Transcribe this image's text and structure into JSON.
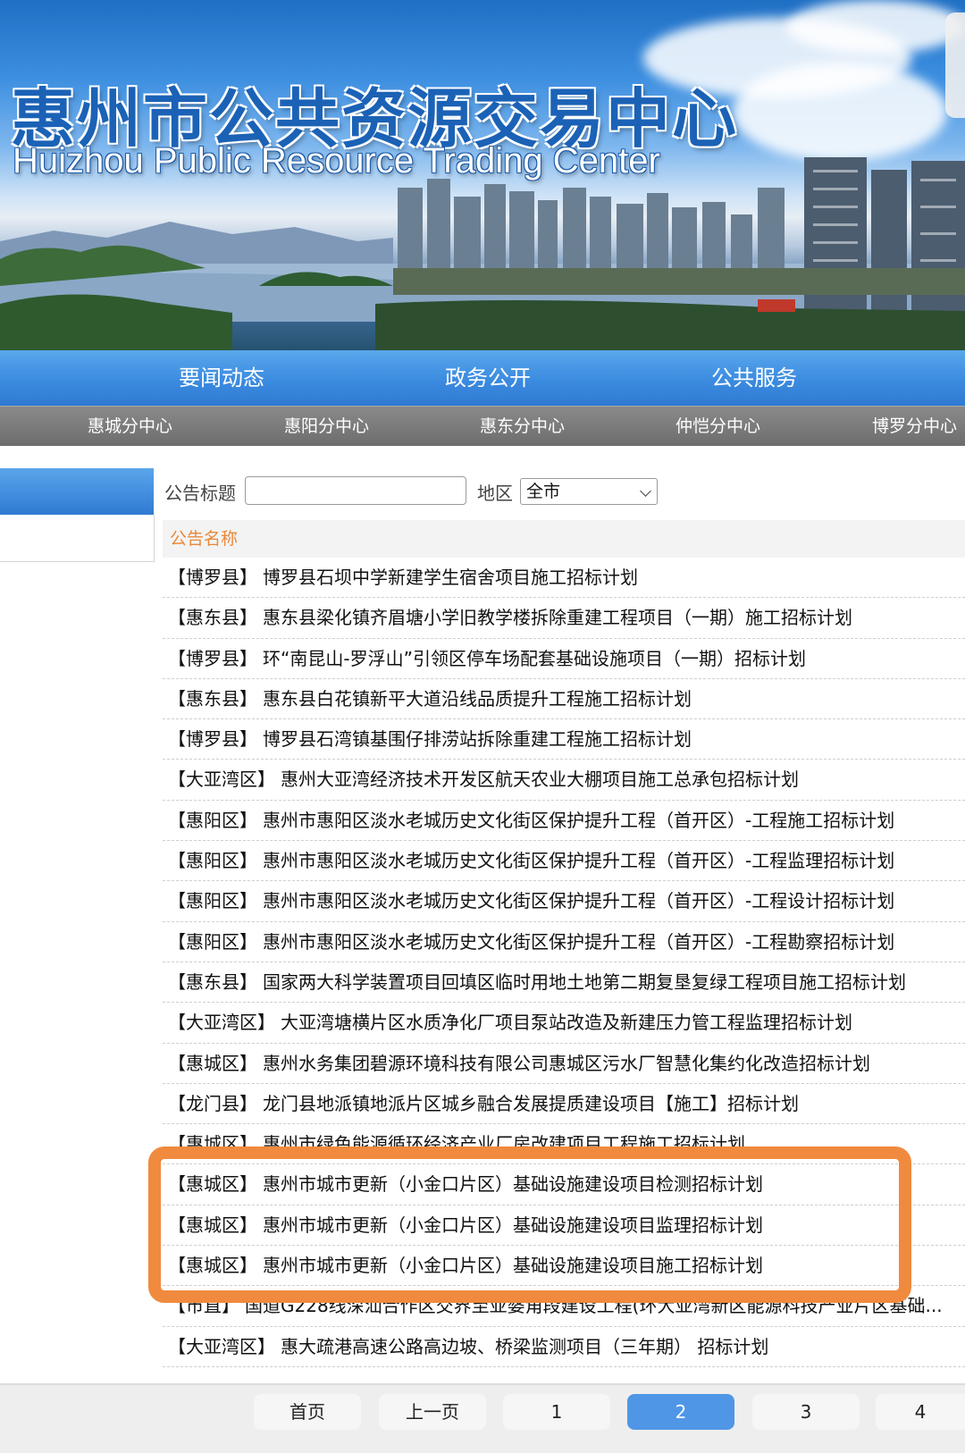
{
  "banner": {
    "title": "惠州市公共资源交易中心",
    "subtitle": "Huizhou Public Resource Trading Center"
  },
  "main_nav": {
    "items": [
      {
        "label": "要闻动态"
      },
      {
        "label": "政务公开"
      },
      {
        "label": "公共服务"
      }
    ]
  },
  "sub_nav": {
    "items": [
      {
        "label": "惠城分中心"
      },
      {
        "label": "惠阳分中心"
      },
      {
        "label": "惠东分中心"
      },
      {
        "label": "仲恺分中心"
      },
      {
        "label": "博罗分中心"
      }
    ]
  },
  "search": {
    "title_label": "公告标题",
    "title_value": "",
    "region_label": "地区",
    "region_selected": "全市"
  },
  "list": {
    "header": "公告名称",
    "items": [
      {
        "region": "【博罗县】",
        "title": "博罗县石坝中学新建学生宿舍项目施工招标计划"
      },
      {
        "region": "【惠东县】",
        "title": "惠东县梁化镇齐眉塘小学旧教学楼拆除重建工程项目（一期）施工招标计划"
      },
      {
        "region": "【博罗县】",
        "title": "环“南昆山-罗浮山”引领区停车场配套基础设施项目（一期）招标计划"
      },
      {
        "region": "【惠东县】",
        "title": "惠东县白花镇新平大道沿线品质提升工程施工招标计划"
      },
      {
        "region": "【博罗县】",
        "title": "博罗县石湾镇基围仔排涝站拆除重建工程施工招标计划"
      },
      {
        "region": "【大亚湾区】",
        "title": "惠州大亚湾经济技术开发区航天农业大棚项目施工总承包招标计划"
      },
      {
        "region": "【惠阳区】",
        "title": "惠州市惠阳区淡水老城历史文化街区保护提升工程（首开区）-工程施工招标计划"
      },
      {
        "region": "【惠阳区】",
        "title": "惠州市惠阳区淡水老城历史文化街区保护提升工程（首开区）-工程监理招标计划"
      },
      {
        "region": "【惠阳区】",
        "title": "惠州市惠阳区淡水老城历史文化街区保护提升工程（首开区）-工程设计招标计划"
      },
      {
        "region": "【惠阳区】",
        "title": "惠州市惠阳区淡水老城历史文化街区保护提升工程（首开区）-工程勘察招标计划"
      },
      {
        "region": "【惠东县】",
        "title": "国家两大科学装置项目回填区临时用地土地第二期复垦复绿工程项目施工招标计划"
      },
      {
        "region": "【大亚湾区】",
        "title": "大亚湾塘横片区水质净化厂项目泵站改造及新建压力管工程监理招标计划"
      },
      {
        "region": "【惠城区】",
        "title": "惠州水务集团碧源环境科技有限公司惠城区污水厂智慧化集约化改造招标计划"
      },
      {
        "region": "【龙门县】",
        "title": "龙门县地派镇地派片区城乡融合发展提质建设项目【施工】招标计划"
      },
      {
        "region": "【惠城区】",
        "title": "惠州市绿色能源循环经济产业厂房改建项目工程施工招标计划"
      },
      {
        "region": "【惠城区】",
        "title": "惠州市城市更新（小金口片区）基础设施建设项目检测招标计划"
      },
      {
        "region": "【惠城区】",
        "title": "惠州市城市更新（小金口片区）基础设施建设项目监理招标计划"
      },
      {
        "region": "【惠城区】",
        "title": "惠州市城市更新（小金口片区）基础设施建设项目施工招标计划"
      },
      {
        "region": "【市直】",
        "title": "国道G228线深汕合作区交界至亚婆角段建设工程(环大亚湾新区能源科技产业片区基础..."
      },
      {
        "region": "【大亚湾区】",
        "title": "惠大疏港高速公路高边坡、桥梁监测项目（三年期） 招标计划"
      }
    ]
  },
  "pagination": {
    "first": "首页",
    "prev": "上一页",
    "pages": [
      "1",
      "2",
      "3",
      "4"
    ],
    "current": "2"
  },
  "colors": {
    "nav_blue": "#3b8be0",
    "sub_nav_gray": "#6d6d6d",
    "header_orange": "#e8893a",
    "highlight_orange": "#f08a3e",
    "active_page_blue": "#4f96e6"
  }
}
